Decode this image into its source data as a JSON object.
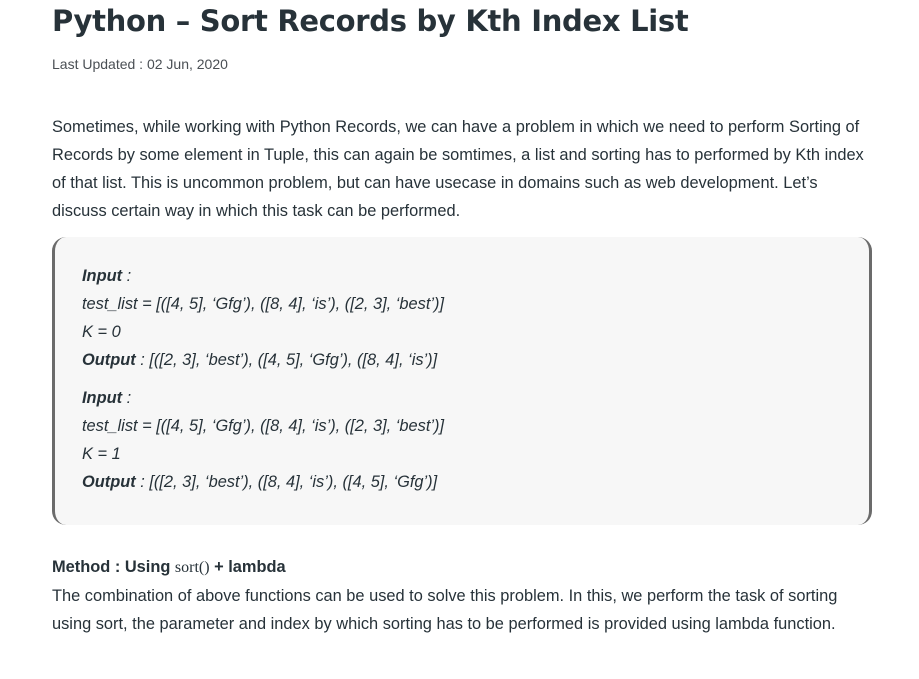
{
  "article": {
    "title": "Python – Sort Records by Kth Index List",
    "last_updated": "Last Updated : 02 Jun, 2020",
    "intro": "Sometimes, while working with Python Records, we can have a problem in which we need to perform Sorting of Records by some element in Tuple, this can again be somtimes, a list and sorting has to performed by Kth index of that list. This is uncommon problem, but can have usecase in domains such as web development. Let’s discuss certain way in which this task can be performed."
  },
  "examples": [
    {
      "input_label": "Input",
      "input_sep": " :",
      "test_list": "test_list = [([4, 5], ‘Gfg’), ([8, 4], ‘is’), ([2, 3], ‘best’)]",
      "k": "K = 0",
      "output_label": "Output",
      "output_value": " : [([2, 3], ‘best’), ([4, 5], ‘Gfg’), ([8, 4], ‘is’)]"
    },
    {
      "input_label": "Input",
      "input_sep": " :",
      "test_list": "test_list = [([4, 5], ‘Gfg’), ([8, 4], ‘is’), ([2, 3], ‘best’)]",
      "k": "K = 1",
      "output_label": "Output",
      "output_value": " : [([2, 3], ‘best’), ([8, 4], ‘is’), ([4, 5], ‘Gfg’)]"
    }
  ],
  "method": {
    "prefix": "Method : Using ",
    "code": "sort()",
    "suffix": " + lambda",
    "description": "The combination of above functions can be used to solve this problem. In this, we perform the task of sorting using sort, the parameter and index by which sorting has to be performed is provided using lambda function."
  }
}
